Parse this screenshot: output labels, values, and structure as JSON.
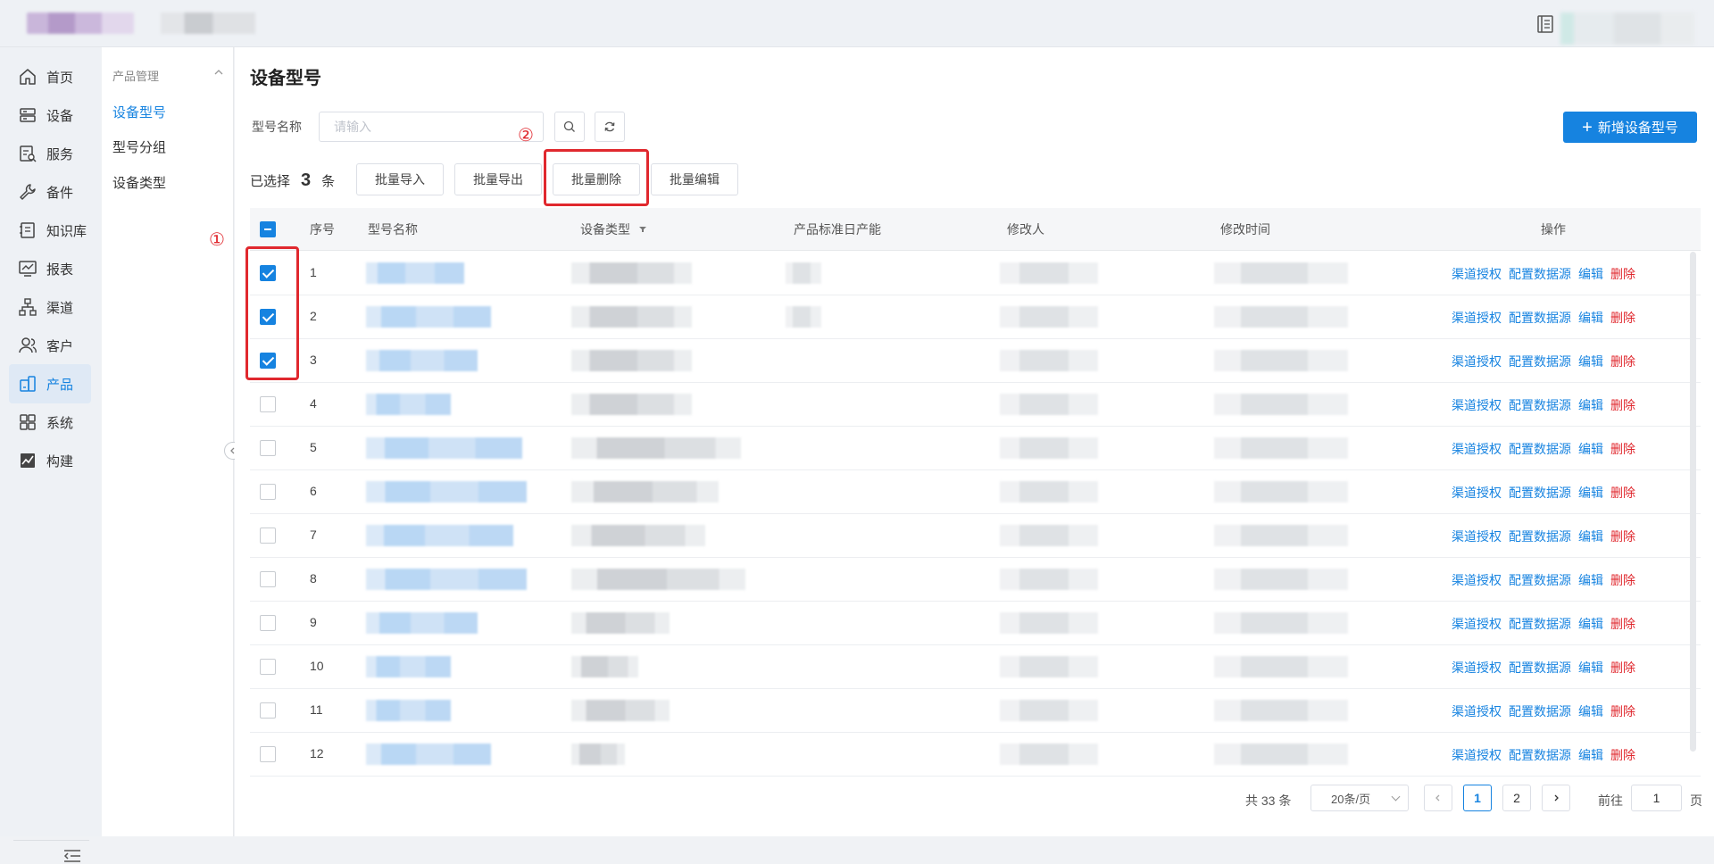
{
  "nav": {
    "items": [
      {
        "label": "首页",
        "icon": "home-icon"
      },
      {
        "label": "设备",
        "icon": "server-icon"
      },
      {
        "label": "服务",
        "icon": "service-doc-icon"
      },
      {
        "label": "备件",
        "icon": "wrench-icon"
      },
      {
        "label": "知识库",
        "icon": "book-icon"
      },
      {
        "label": "报表",
        "icon": "chart-monitor-icon"
      },
      {
        "label": "渠道",
        "icon": "org-tree-icon"
      },
      {
        "label": "客户",
        "icon": "users-icon"
      },
      {
        "label": "产品",
        "icon": "product-icon"
      },
      {
        "label": "系统",
        "icon": "grid-icon"
      },
      {
        "label": "构建",
        "icon": "line-chart-icon"
      }
    ],
    "active_index": 8
  },
  "subnav": {
    "group": "产品管理",
    "items": [
      "设备型号",
      "型号分组",
      "设备类型"
    ],
    "active_index": 0
  },
  "page": {
    "title": "设备型号",
    "filter_label": "型号名称",
    "search_placeholder": "请输入",
    "add_button": "新增设备型号",
    "selected_prefix": "已选择",
    "selected_count": "3",
    "selected_suffix": "条",
    "bulk_buttons": [
      "批量导入",
      "批量导出",
      "批量删除",
      "批量编辑"
    ]
  },
  "annotations": {
    "one": "①",
    "two": "②"
  },
  "table": {
    "columns": [
      "序号",
      "型号名称",
      "设备类型",
      "产品标准日产能",
      "修改人",
      "修改时间",
      "操作"
    ],
    "actions": [
      "渠道授权",
      "配置数据源",
      "编辑",
      "删除"
    ],
    "rows": [
      {
        "no": "1",
        "checked": true
      },
      {
        "no": "2",
        "checked": true
      },
      {
        "no": "3",
        "checked": true
      },
      {
        "no": "4",
        "checked": false
      },
      {
        "no": "5",
        "checked": false
      },
      {
        "no": "6",
        "checked": false
      },
      {
        "no": "7",
        "checked": false
      },
      {
        "no": "8",
        "checked": false
      },
      {
        "no": "9",
        "checked": false
      },
      {
        "no": "10",
        "checked": false
      },
      {
        "no": "11",
        "checked": false
      },
      {
        "no": "12",
        "checked": false
      }
    ]
  },
  "pagination": {
    "total": "共 33 条",
    "page_size": "20条/页",
    "pages": [
      "1",
      "2"
    ],
    "current": "1",
    "goto_prefix": "前往",
    "goto_value": "1",
    "goto_suffix": "页"
  },
  "colors": {
    "accent": "#1683e0",
    "danger": "#e0282e"
  }
}
